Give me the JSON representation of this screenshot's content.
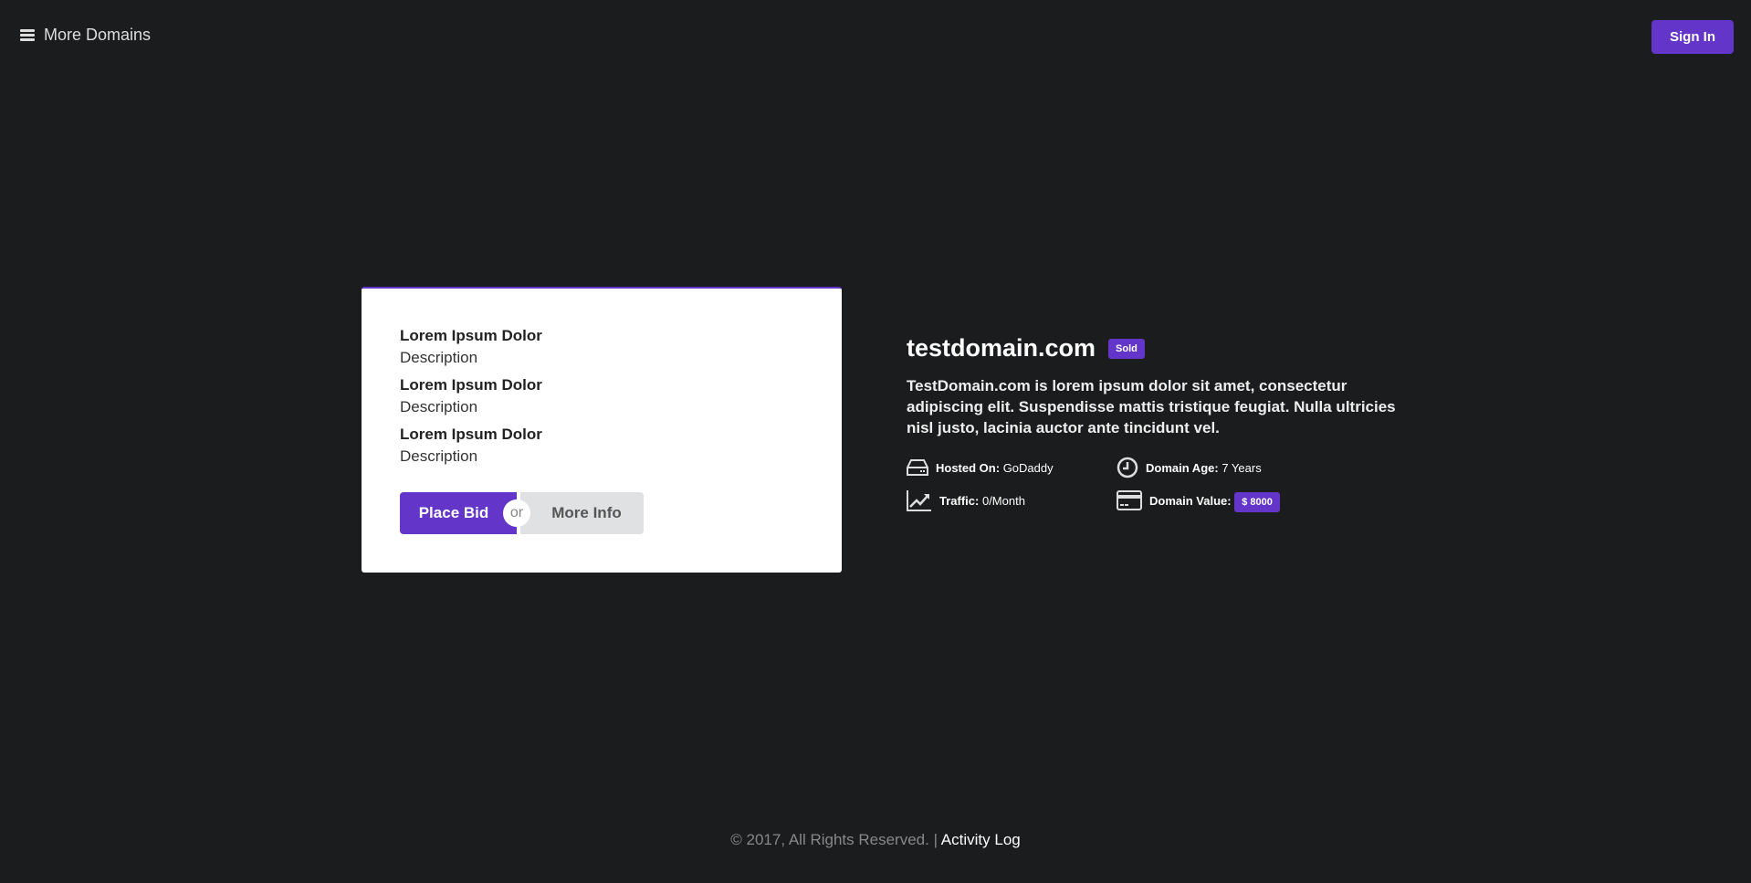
{
  "nav": {
    "menu_label": "More Domains",
    "signin_label": "Sign In"
  },
  "card": {
    "items": [
      {
        "title": "Lorem Ipsum Dolor",
        "description": "Description"
      },
      {
        "title": "Lorem Ipsum Dolor",
        "description": "Description"
      },
      {
        "title": "Lorem Ipsum Dolor",
        "description": "Description"
      }
    ],
    "place_bid": "Place Bid",
    "or": "or",
    "more_info": "More Info"
  },
  "domain": {
    "name": "testdomain.com",
    "status": "Sold",
    "description": "TestDomain.com is lorem ipsum dolor sit amet, consectetur adipiscing elit. Suspendisse mattis tristique feugiat. Nulla ultricies nisl justo, lacinia auctor ante tincidunt vel.",
    "hosted_label": "Hosted On:",
    "hosted_value": "GoDaddy",
    "age_label": "Domain Age:",
    "age_value": "7 Years",
    "traffic_label": "Traffic:",
    "traffic_value": "0/Month",
    "value_label": "Domain Value:",
    "value_value": "$ 8000"
  },
  "footer": {
    "copyright": "© 2017, All Rights Reserved. |",
    "activity_link": "Activity Log"
  },
  "colors": {
    "accent": "#6435c9",
    "background": "#1b1c1d"
  }
}
